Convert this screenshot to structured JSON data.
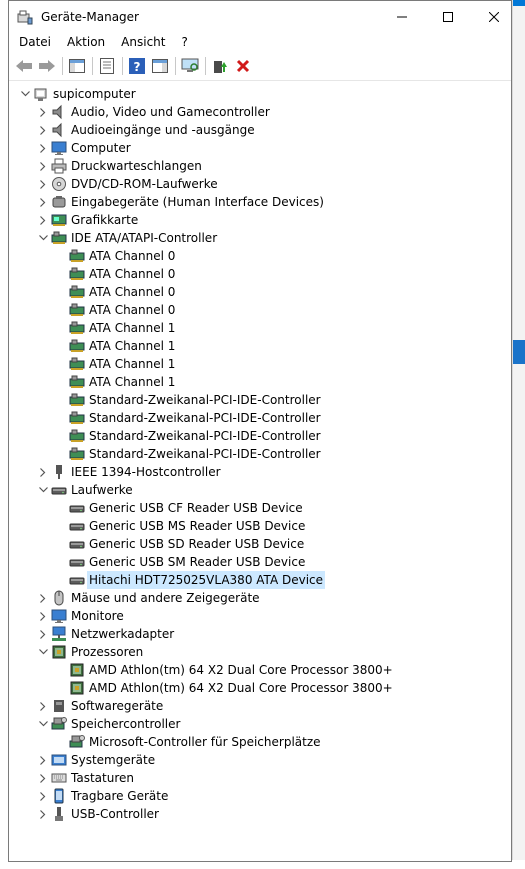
{
  "window": {
    "title": "Geräte-Manager"
  },
  "menu": [
    "Datei",
    "Aktion",
    "Ansicht",
    "?"
  ],
  "toolbar": {
    "buttons": [
      "back-icon",
      "forward-icon",
      "show-hide-console-tree-icon",
      "properties-icon",
      "help-icon",
      "show-hide-action-pane-icon",
      "scan-hardware-icon",
      "update-driver-icon",
      "uninstall-icon"
    ]
  },
  "tree": [
    {
      "level": 0,
      "label": "supicomputer",
      "expand": "open",
      "icon": "computer"
    },
    {
      "level": 1,
      "label": "Audio, Video und Gamecontroller",
      "expand": "closed",
      "icon": "speaker"
    },
    {
      "level": 1,
      "label": "Audioeingänge und -ausgänge",
      "expand": "closed",
      "icon": "speaker"
    },
    {
      "level": 1,
      "label": "Computer",
      "expand": "closed",
      "icon": "monitor"
    },
    {
      "level": 1,
      "label": "Druckwarteschlangen",
      "expand": "closed",
      "icon": "printer"
    },
    {
      "level": 1,
      "label": "DVD/CD-ROM-Laufwerke",
      "expand": "closed",
      "icon": "disc"
    },
    {
      "level": 1,
      "label": "Eingabegeräte (Human Interface Devices)",
      "expand": "closed",
      "icon": "hid"
    },
    {
      "level": 1,
      "label": "Grafikkarte",
      "expand": "closed",
      "icon": "display-adapter"
    },
    {
      "level": 1,
      "label": "IDE ATA/ATAPI-Controller",
      "expand": "open",
      "icon": "ide"
    },
    {
      "level": 2,
      "label": "ATA Channel 0",
      "expand": "none",
      "icon": "ide"
    },
    {
      "level": 2,
      "label": "ATA Channel 0",
      "expand": "none",
      "icon": "ide"
    },
    {
      "level": 2,
      "label": "ATA Channel 0",
      "expand": "none",
      "icon": "ide"
    },
    {
      "level": 2,
      "label": "ATA Channel 0",
      "expand": "none",
      "icon": "ide"
    },
    {
      "level": 2,
      "label": "ATA Channel 1",
      "expand": "none",
      "icon": "ide"
    },
    {
      "level": 2,
      "label": "ATA Channel 1",
      "expand": "none",
      "icon": "ide"
    },
    {
      "level": 2,
      "label": "ATA Channel 1",
      "expand": "none",
      "icon": "ide"
    },
    {
      "level": 2,
      "label": "ATA Channel 1",
      "expand": "none",
      "icon": "ide"
    },
    {
      "level": 2,
      "label": "Standard-Zweikanal-PCI-IDE-Controller",
      "expand": "none",
      "icon": "ide"
    },
    {
      "level": 2,
      "label": "Standard-Zweikanal-PCI-IDE-Controller",
      "expand": "none",
      "icon": "ide"
    },
    {
      "level": 2,
      "label": "Standard-Zweikanal-PCI-IDE-Controller",
      "expand": "none",
      "icon": "ide"
    },
    {
      "level": 2,
      "label": "Standard-Zweikanal-PCI-IDE-Controller",
      "expand": "none",
      "icon": "ide"
    },
    {
      "level": 1,
      "label": "IEEE 1394-Hostcontroller",
      "expand": "closed",
      "icon": "ieee1394"
    },
    {
      "level": 1,
      "label": "Laufwerke",
      "expand": "open",
      "icon": "drive"
    },
    {
      "level": 2,
      "label": "Generic USB CF Reader USB Device",
      "expand": "none",
      "icon": "drive"
    },
    {
      "level": 2,
      "label": "Generic USB MS Reader USB Device",
      "expand": "none",
      "icon": "drive"
    },
    {
      "level": 2,
      "label": "Generic USB SD Reader USB Device",
      "expand": "none",
      "icon": "drive"
    },
    {
      "level": 2,
      "label": "Generic USB SM Reader USB Device",
      "expand": "none",
      "icon": "drive"
    },
    {
      "level": 2,
      "label": "Hitachi HDT725025VLA380 ATA Device",
      "expand": "none",
      "icon": "drive",
      "selected": true
    },
    {
      "level": 1,
      "label": "Mäuse und andere Zeigegeräte",
      "expand": "closed",
      "icon": "mouse"
    },
    {
      "level": 1,
      "label": "Monitore",
      "expand": "closed",
      "icon": "monitor"
    },
    {
      "level": 1,
      "label": "Netzwerkadapter",
      "expand": "closed",
      "icon": "network"
    },
    {
      "level": 1,
      "label": "Prozessoren",
      "expand": "open",
      "icon": "cpu"
    },
    {
      "level": 2,
      "label": "AMD Athlon(tm) 64 X2 Dual Core Processor 3800+",
      "expand": "none",
      "icon": "cpu"
    },
    {
      "level": 2,
      "label": "AMD Athlon(tm) 64 X2 Dual Core Processor 3800+",
      "expand": "none",
      "icon": "cpu"
    },
    {
      "level": 1,
      "label": "Softwaregeräte",
      "expand": "closed",
      "icon": "software"
    },
    {
      "level": 1,
      "label": "Speichercontroller",
      "expand": "open",
      "icon": "storage"
    },
    {
      "level": 2,
      "label": "Microsoft-Controller für Speicherplätze",
      "expand": "none",
      "icon": "storage"
    },
    {
      "level": 1,
      "label": "Systemgeräte",
      "expand": "closed",
      "icon": "system"
    },
    {
      "level": 1,
      "label": "Tastaturen",
      "expand": "closed",
      "icon": "keyboard"
    },
    {
      "level": 1,
      "label": "Tragbare Geräte",
      "expand": "closed",
      "icon": "portable"
    },
    {
      "level": 1,
      "label": "USB-Controller",
      "expand": "closed",
      "icon": "usb"
    }
  ]
}
